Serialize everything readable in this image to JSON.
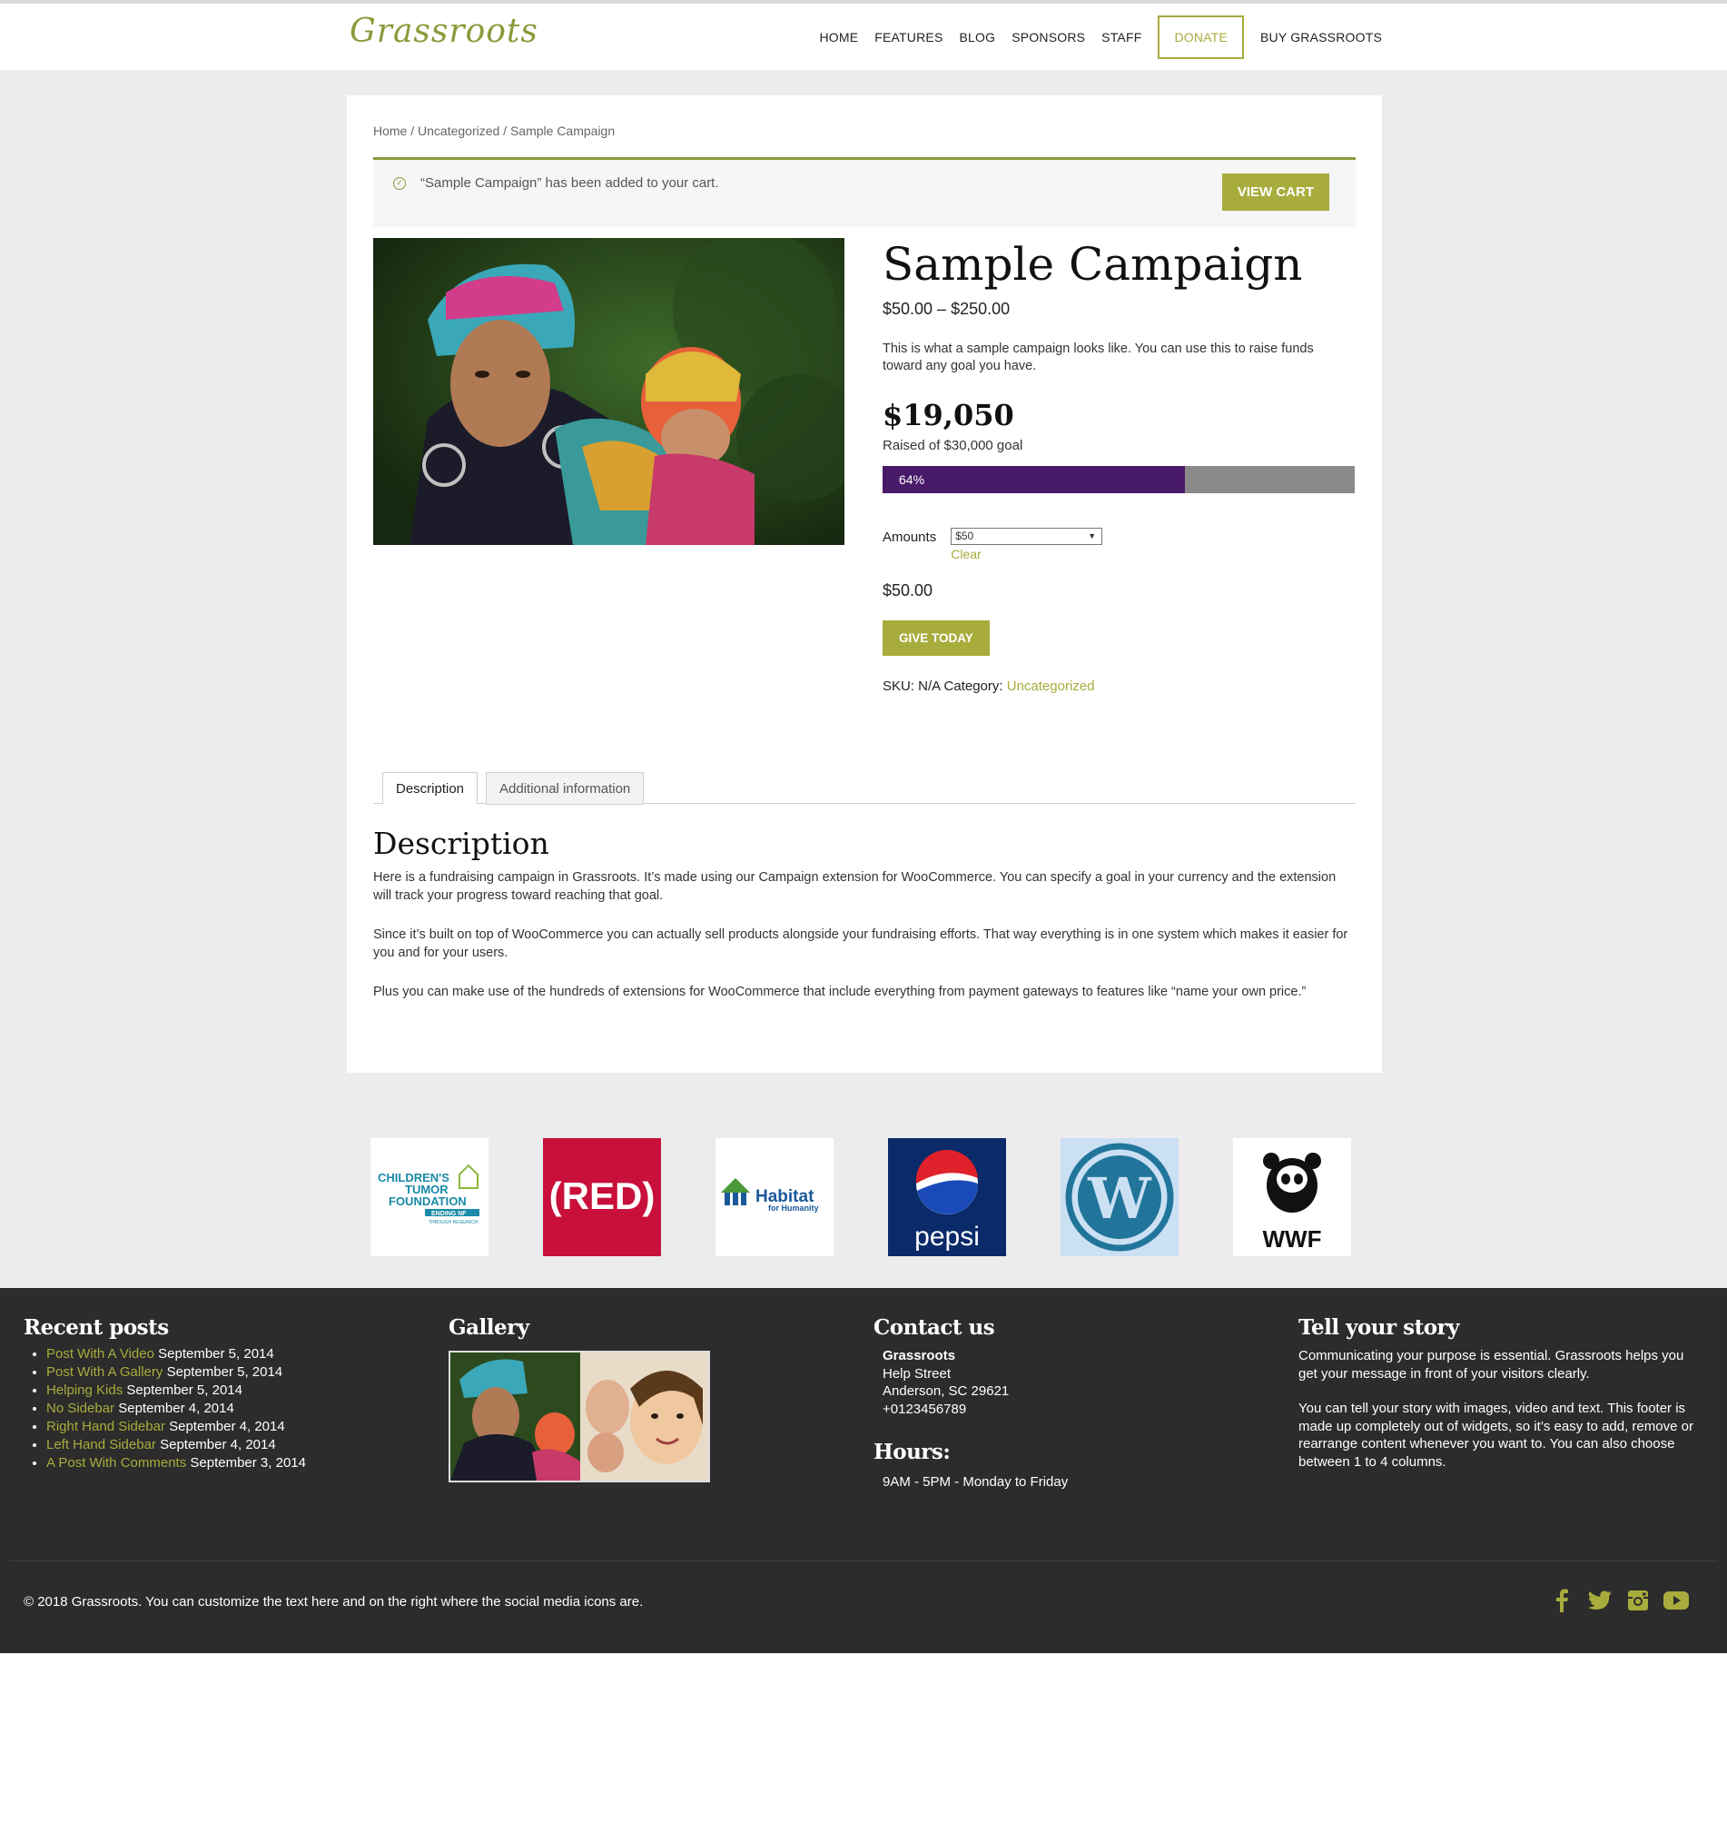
{
  "header": {
    "logo": "Grassroots",
    "nav": [
      "HOME",
      "FEATURES",
      "BLOG",
      "SPONSORS",
      "STAFF",
      "DONATE",
      "BUY GRASSROOTS"
    ]
  },
  "breadcrumb": "Home / Uncategorized / Sample Campaign",
  "notice": {
    "text": "“Sample Campaign” has been added to your cart.",
    "button": "VIEW CART"
  },
  "product": {
    "title": "Sample Campaign",
    "price_range": "$50.00 – $250.00",
    "short_description": "This is what a sample campaign looks like. You can use this to raise funds toward any goal you have.",
    "raised": "$19,050",
    "goal_text": "Raised of $30,000 goal",
    "progress_label": "64%",
    "progress_fraction": 0.64,
    "amounts_label": "Amounts",
    "amount_selected": "$50",
    "clear_label": "Clear",
    "selected_price": "$50.00",
    "give_button": "GIVE TODAY",
    "sku_text": "SKU: N/A Category:",
    "category": "Uncategorized"
  },
  "tabs": [
    "Description",
    "Additional information"
  ],
  "description": {
    "heading": "Description",
    "paragraphs": [
      "Here is a fundraising campaign in Grassroots. It’s made using our Campaign extension for WooCommerce. You can specify a goal in your currency and the extension will track your progress toward reaching that goal.",
      "Since it’s built on top of WooCommerce you can actually sell products alongside your fundraising efforts. That way everything is in one system which makes it easier for you and for your users.",
      "Plus you can make use of the hundreds of extensions for WooCommerce that include everything from payment gateways to features like “name your own price.”"
    ]
  },
  "sponsors": {
    "ctf": [
      "CHILDREN'S",
      "TUMOR",
      "FOUNDATION",
      "ENDING NF",
      "THROUGH RESEARCH"
    ],
    "red": "(RED)",
    "habitat": [
      "Habitat",
      "for Humanity"
    ],
    "pepsi": "pepsi",
    "wwf": "WWF"
  },
  "footer": {
    "recent_heading": "Recent posts",
    "recent_posts": [
      {
        "title": "Post With A Video",
        "date": "September 5, 2014"
      },
      {
        "title": "Post With A Gallery",
        "date": "September 5, 2014"
      },
      {
        "title": "Helping Kids",
        "date": "September 5, 2014"
      },
      {
        "title": "No Sidebar",
        "date": "September 4, 2014"
      },
      {
        "title": "Right Hand Sidebar",
        "date": "September 4, 2014"
      },
      {
        "title": "Left Hand Sidebar",
        "date": "September 4, 2014"
      },
      {
        "title": "A Post With Comments",
        "date": "September 3, 2014"
      }
    ],
    "gallery_heading": "Gallery",
    "contact_heading": "Contact us",
    "contact_name": "Grassroots",
    "contact_lines": [
      "Help Street",
      "Anderson, SC 29621",
      "+0123456789"
    ],
    "hours_heading": "Hours:",
    "hours": "9AM - 5PM - Monday to Friday",
    "story_heading": "Tell your story",
    "story_paragraphs": [
      "Communicating your purpose is essential. Grassroots helps you get your message in front of your visitors clearly.",
      "You can tell your story with images, video and text. This footer is made up completely out of widgets, so it’s easy to add, remove or rearrange content whenever you want to. You can also choose between 1 to 4 columns."
    ],
    "copyright": "© 2018 Grassroots. You can customize the text here and on the right where the social media icons are.",
    "social_icons": [
      "facebook-icon",
      "twitter-icon",
      "instagram-icon",
      "youtube-icon"
    ]
  },
  "colors": {
    "accent": "#a8ac3c",
    "progress_fill": "#4a1a6a",
    "footer_bg": "#2c2c2c"
  }
}
